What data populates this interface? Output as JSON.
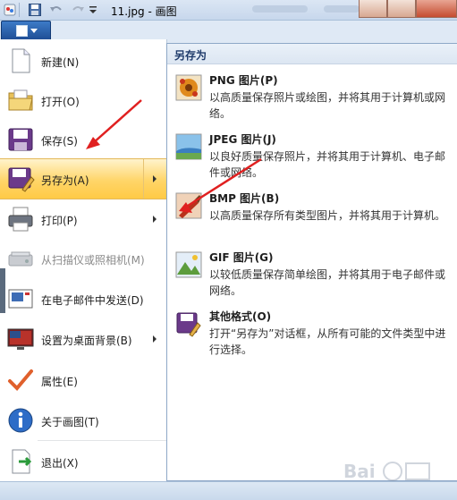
{
  "titlebar": {
    "title": "11.jpg - 画图"
  },
  "app_menu": {
    "items": [
      {
        "label": "新建(N)",
        "icon": "new-file-icon"
      },
      {
        "label": "打开(O)",
        "icon": "open-folder-icon"
      },
      {
        "label": "保存(S)",
        "icon": "save-disk-icon"
      },
      {
        "label": "另存为(A)",
        "icon": "save-as-icon",
        "active": true,
        "submenu": true
      },
      {
        "label": "打印(P)",
        "icon": "printer-icon",
        "submenu": true
      },
      {
        "label": "从扫描仪或照相机(M)",
        "icon": "scanner-icon",
        "disabled": true
      },
      {
        "label": "在电子邮件中发送(D)",
        "icon": "email-icon"
      },
      {
        "label": "设置为桌面背景(B)",
        "icon": "desktop-icon",
        "submenu": true
      },
      {
        "label": "属性(E)",
        "icon": "checkmark-icon"
      },
      {
        "label": "关于画图(T)",
        "icon": "info-icon"
      },
      {
        "label": "退出(X)",
        "icon": "exit-icon"
      }
    ]
  },
  "save_as_menu": {
    "header": "另存为",
    "items": [
      {
        "title": "PNG 图片(P)",
        "desc": "以高质量保存照片或绘图，并将其用于计算机或网络。",
        "icon": "png-image-icon"
      },
      {
        "title": "JPEG 图片(J)",
        "desc": "以良好质量保存照片，并将其用于计算机、电子邮件或网络。",
        "icon": "jpeg-image-icon"
      },
      {
        "title": "BMP 图片(B)",
        "desc": "以高质量保存所有类型图片，并将其用于计算机。",
        "icon": "bmp-image-icon"
      },
      {
        "title": "GIF 图片(G)",
        "desc": "以较低质量保存简单绘图，并将其用于电子邮件或网络。",
        "icon": "gif-image-icon"
      },
      {
        "title": "其他格式(O)",
        "desc": "打开“另存为”对话框，从所有可能的文件类型中进行选择。",
        "icon": "other-formats-icon"
      }
    ]
  },
  "colors": {
    "accent_blue": "#2a5fa8",
    "highlight": "#ffd568",
    "annotation_red": "#e02020"
  }
}
